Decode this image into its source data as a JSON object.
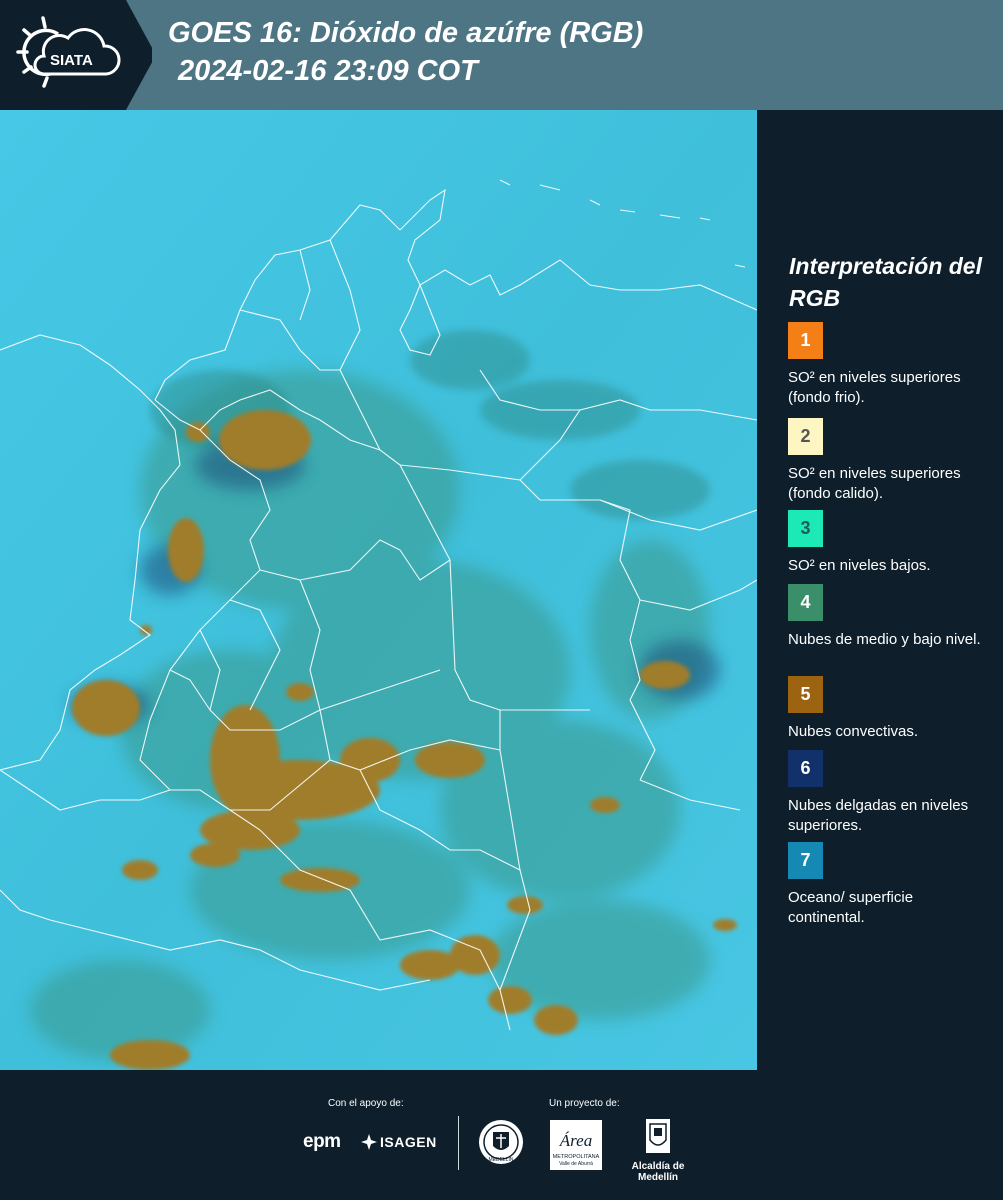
{
  "header": {
    "logo_text": "SIATA",
    "title_line1": "GOES 16: Dióxido de azúfre (RGB)",
    "title_line2": "2024-02-16 23:09 COT",
    "bg_color": "#4e7584"
  },
  "map": {
    "background_color": "#3fc4e0",
    "cloud_color_convective": "#9a7a2a",
    "cloud_color_low": "#3f9e8e",
    "border_color": "#ffffff"
  },
  "legend": {
    "title": "Interpretación del RGB",
    "items": [
      {
        "number": "1",
        "color": "#f57f17",
        "text_color": "#ffffff",
        "description": "SO² en niveles superiores (fondo frio)."
      },
      {
        "number": "2",
        "color": "#fdf6c3",
        "text_color": "#555555",
        "description": "SO² en niveles superiores (fondo calido)."
      },
      {
        "number": "3",
        "color": "#1de9b6",
        "text_color": "#1a5f55",
        "description": "SO² en niveles bajos."
      },
      {
        "number": "4",
        "color": "#3a8f6a",
        "text_color": "#ffffff",
        "description": "Nubes de medio y bajo nivel."
      },
      {
        "number": "5",
        "color": "#9c6410",
        "text_color": "#ffffff",
        "description": "Nubes convectivas."
      },
      {
        "number": "6",
        "color": "#12306a",
        "text_color": "#ffffff",
        "description": "Nubes delgadas en niveles superiores."
      },
      {
        "number": "7",
        "color": "#1589b3",
        "text_color": "#ffffff",
        "description": "Oceano/ superficie continental."
      }
    ]
  },
  "footer": {
    "support_label": "Con el apoyo de:",
    "project_label": "Un proyecto de:",
    "epm": "epm",
    "isagen": "ISAGEN",
    "area_name": "Área",
    "area_sub1": "METROPOLITANA",
    "area_sub2": "Valle de Aburrá",
    "alcaldia": "Alcaldía de Medellín",
    "seal_text": "MEDELLÍN"
  }
}
